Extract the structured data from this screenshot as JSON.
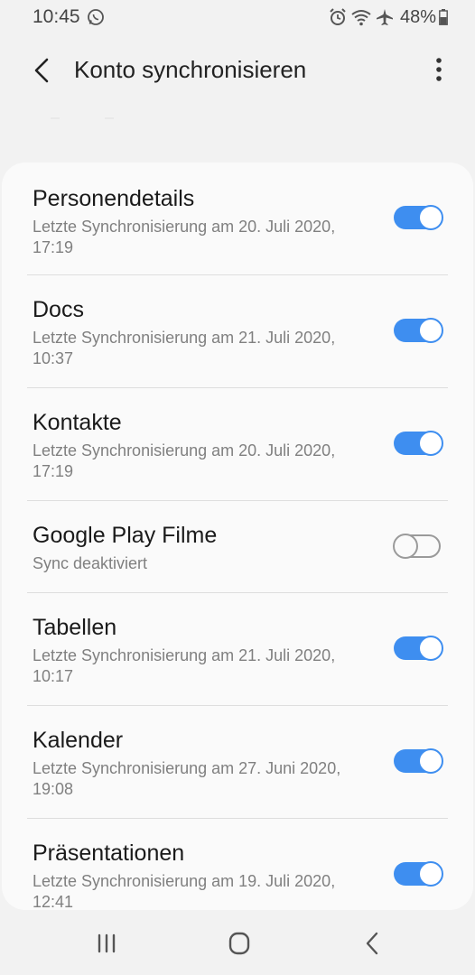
{
  "status_bar": {
    "time": "10:45",
    "battery": "48%",
    "left_icons": [
      "whatsapp-icon"
    ],
    "right_icons": [
      "alarm-icon",
      "wifi-icon",
      "airplane-mode-icon",
      "battery-icon"
    ]
  },
  "app_bar": {
    "title": "Konto synchronisieren"
  },
  "colors": {
    "accent": "#3e8ef0",
    "background": "#f2f2f2",
    "card": "#fafafa"
  },
  "sync_items": [
    {
      "title": "Personendetails",
      "subtitle": "Letzte Synchronisierung am 20. Juli 2020, 17:19",
      "enabled": true
    },
    {
      "title": "Docs",
      "subtitle": "Letzte Synchronisierung am 21. Juli 2020, 10:37",
      "enabled": true
    },
    {
      "title": "Kontakte",
      "subtitle": "Letzte Synchronisierung am 20. Juli 2020, 17:19",
      "enabled": true
    },
    {
      "title": "Google Play Filme",
      "subtitle": "Sync deaktiviert",
      "enabled": false
    },
    {
      "title": "Tabellen",
      "subtitle": "Letzte Synchronisierung am 21. Juli 2020, 10:17",
      "enabled": true
    },
    {
      "title": "Kalender",
      "subtitle": "Letzte Synchronisierung am 27. Juni 2020, 19:08",
      "enabled": true
    },
    {
      "title": "Präsentationen",
      "subtitle": "Letzte Synchronisierung am 19. Juli 2020, 12:41",
      "enabled": true
    }
  ],
  "nav_bar": {
    "buttons": [
      "recent-apps-icon",
      "home-icon",
      "back-icon"
    ]
  }
}
